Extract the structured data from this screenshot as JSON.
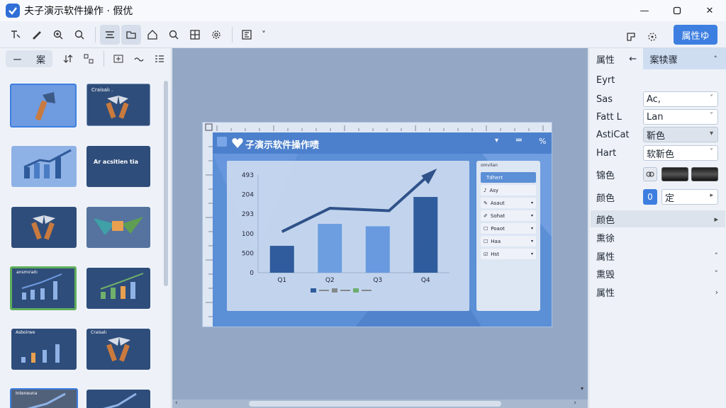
{
  "window": {
    "title": "夫子演示软件操作 · 假优"
  },
  "toolbar": {
    "primary_label": "属性ゆ"
  },
  "left_panel": {
    "tab_a": "ー",
    "tab_b": "案"
  },
  "thumbnails": [
    {
      "caption": ""
    },
    {
      "caption": "Craisalı ."
    },
    {
      "caption": ""
    },
    {
      "caption": "Ar acsitien tia"
    },
    {
      "caption": ""
    },
    {
      "caption": ""
    },
    {
      "caption": "ansmıraıtı"
    },
    {
      "caption": ""
    },
    {
      "caption": "Asboirwe"
    },
    {
      "caption": "Craisalı"
    },
    {
      "caption": "Inteneuna"
    },
    {
      "caption": ""
    }
  ],
  "slide": {
    "title": "子演示软件操作啧",
    "header_right": "%",
    "menu_header": "omvilan",
    "menu_items": [
      {
        "label": "Tdhert"
      },
      {
        "label": "Asy"
      },
      {
        "label": "Asaut"
      },
      {
        "label": "Sohat"
      },
      {
        "label": "Poaot"
      },
      {
        "label": "Haa"
      },
      {
        "label": "Hst"
      }
    ]
  },
  "chart_data": {
    "type": "bar",
    "categories": [
      "Q1",
      "Q2",
      "Q3",
      "Q4"
    ],
    "values": [
      110,
      200,
      190,
      310
    ],
    "ytick_labels": [
      "0",
      "500",
      "100",
      "293",
      "204",
      "493"
    ],
    "series_colors": [
      "#2e5a9a",
      "#6f9fe0",
      "#6a9be0",
      "#2e5a9a"
    ],
    "ylim": [
      0,
      400
    ]
  },
  "right_panel": {
    "tab1": "属性",
    "tab2": "案犊骤",
    "heading": "Eyrt",
    "rows": [
      {
        "label": "Sas",
        "value": "Ac,"
      },
      {
        "label": "Fatt L",
        "value": "Lan"
      },
      {
        "label": "AstiCat",
        "value": "靳色"
      },
      {
        "label": "Hart",
        "value": "软靳色"
      }
    ],
    "color_row_1_label": "锦色",
    "color_row_2_label": "颜色",
    "number_value": "0",
    "color_text": "定",
    "sections": [
      {
        "label": "颜色",
        "chevron": "▸"
      },
      {
        "label": "熏徐",
        "chevron": ""
      },
      {
        "label": "属性",
        "chevron": "˄"
      },
      {
        "label": "熏毁",
        "chevron": "˅"
      },
      {
        "label": "属性",
        "chevron": "›"
      }
    ]
  }
}
